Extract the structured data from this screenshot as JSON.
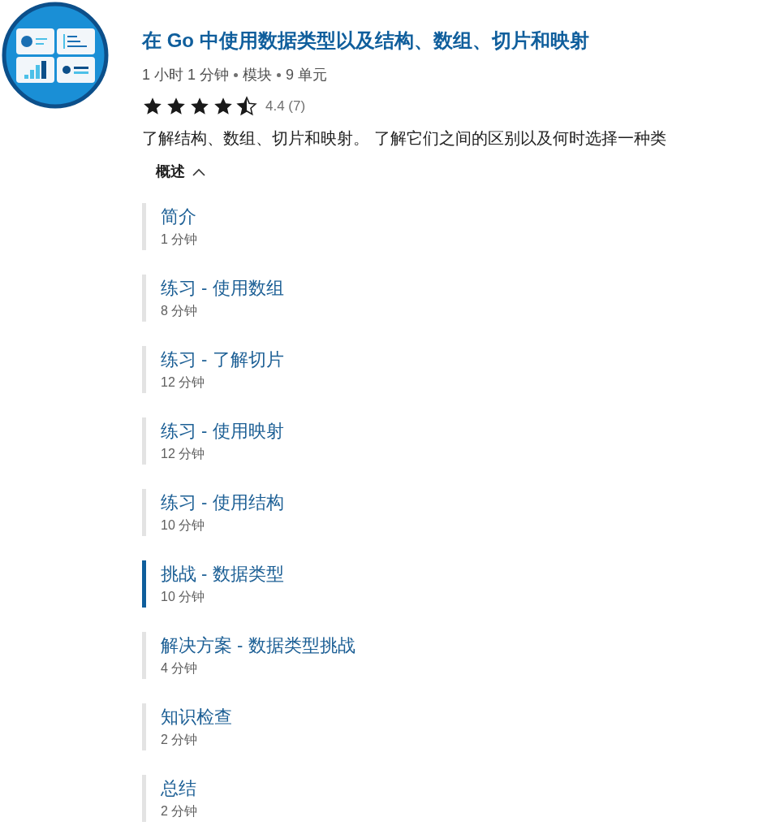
{
  "module": {
    "title": "在 Go 中使用数据类型以及结构、数组、切片和映射",
    "meta": [
      "1 小时 1 分钟",
      "模块",
      "9 单元"
    ],
    "rating": {
      "stars": 4.5,
      "label": "4.4 (7)"
    },
    "description": "了解结构、数组、切片和映射。 了解它们之间的区别以及何时选择一种类"
  },
  "overview": {
    "label": "概述",
    "expanded": true
  },
  "units": [
    {
      "title": "简介",
      "duration": "1 分钟",
      "selected": false
    },
    {
      "title": "练习 - 使用数组",
      "duration": "8 分钟",
      "selected": false
    },
    {
      "title": "练习 - 了解切片",
      "duration": "12 分钟",
      "selected": false
    },
    {
      "title": "练习 - 使用映射",
      "duration": "12 分钟",
      "selected": false
    },
    {
      "title": "练习 - 使用结构",
      "duration": "10 分钟",
      "selected": false
    },
    {
      "title": "挑战 - 数据类型",
      "duration": "10 分钟",
      "selected": true
    },
    {
      "title": "解决方案 - 数据类型挑战",
      "duration": "4 分钟",
      "selected": false
    },
    {
      "title": "知识检查",
      "duration": "2 分钟",
      "selected": false
    },
    {
      "title": "总结",
      "duration": "2 分钟",
      "selected": false
    }
  ]
}
